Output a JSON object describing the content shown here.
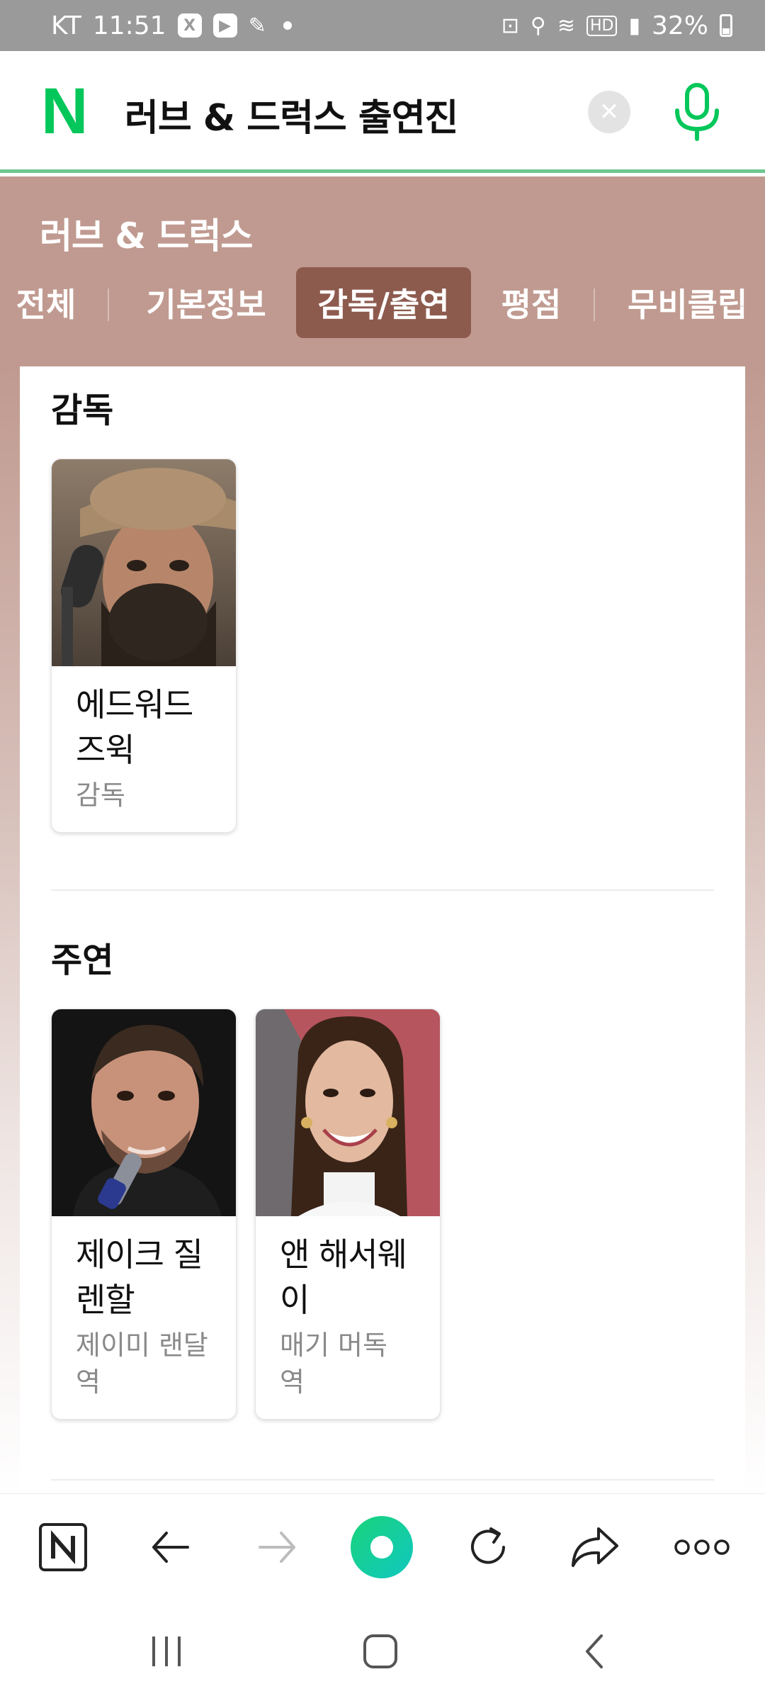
{
  "status_bar": {
    "carrier": "KT",
    "time": "11:51",
    "battery": "32%"
  },
  "search": {
    "logo": "N",
    "query": "러브 & 드럭스 출연진",
    "clear_icon": "close-icon",
    "mic_icon": "microphone-icon"
  },
  "movie": {
    "title": "러브 & 드럭스",
    "tabs": [
      {
        "label": "전체",
        "active": false
      },
      {
        "label": "기본정보",
        "active": false
      },
      {
        "label": "감독/출연",
        "active": true
      },
      {
        "label": "평점",
        "active": false
      },
      {
        "label": "무비클립",
        "active": false
      }
    ]
  },
  "sections": {
    "director": {
      "title": "감독",
      "people": [
        {
          "name": "에드워드 즈윅",
          "role": "감독"
        }
      ]
    },
    "lead": {
      "title": "주연",
      "people": [
        {
          "name": "제이크 질렌할",
          "role": "제이미 랜달 역"
        },
        {
          "name": "앤 해서웨이",
          "role": "매기 머독 역"
        }
      ]
    }
  },
  "toolbar": {
    "items": [
      "naver-home-icon",
      "back-arrow-icon",
      "forward-arrow-icon",
      "green-dot-icon",
      "refresh-icon",
      "share-icon",
      "more-icon"
    ]
  },
  "colors": {
    "naver_green": "#03c75a",
    "header_bg": "#c09a90",
    "active_tab": "#8d5b4e"
  }
}
